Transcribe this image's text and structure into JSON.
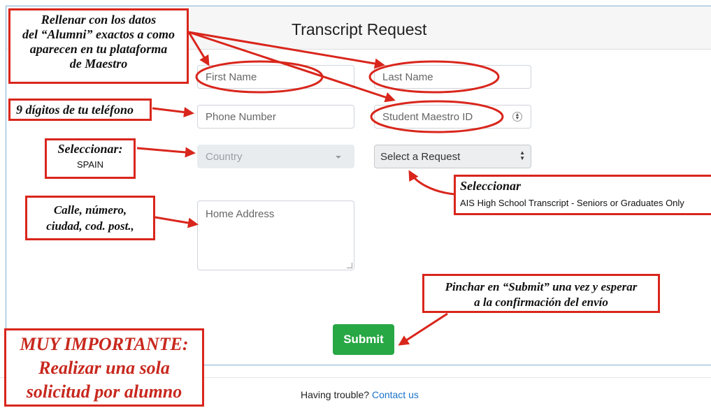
{
  "form": {
    "title": "Transcript Request",
    "first_name_placeholder": "First Name",
    "last_name_placeholder": "Last Name",
    "phone_placeholder": "Phone Number",
    "maestro_id_placeholder": "Student Maestro ID",
    "country_placeholder": "Country",
    "request_selected": "Select a Request",
    "address_placeholder": "Home Address",
    "submit_label": "Submit"
  },
  "footer": {
    "text": "Having trouble?",
    "link": "Contact us"
  },
  "annotations": {
    "alumni_line1": "Rellenar con los datos",
    "alumni_line2": "del “Alumni” exactos a como",
    "alumni_line3": "aparecen en tu plataforma",
    "alumni_line4": "de Maestro",
    "phone_note": "9 dígitos de tu teléfono",
    "country_note": "Seleccionar:",
    "country_value": "SPAIN",
    "address_line1": "Calle, número,",
    "address_line2": "ciudad, cod. post.,",
    "request_note": "Seleccionar",
    "request_value": "AIS High School Transcript - Seniors or Graduates Only",
    "submit_line1": "Pinchar en “Submit” una vez y esperar",
    "submit_line2": "a la confirmación del envío",
    "important_line1": "MUY IMPORTANTE:",
    "important_line2": "Realizar una sola",
    "important_line3": "solicitud por alumno"
  },
  "colors": {
    "annotation_red": "#d9261c",
    "submit_green": "#28a745",
    "link_blue": "#1a73c9"
  }
}
